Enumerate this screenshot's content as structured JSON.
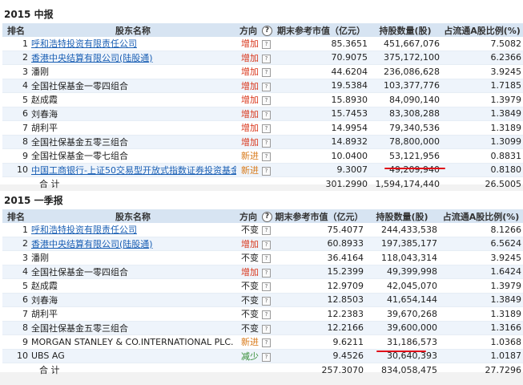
{
  "headers": {
    "rank": "排名",
    "name": "股东名称",
    "dir": "方向",
    "q": "?",
    "value": "期末参考市值（亿元）",
    "shares": "持股数量(股)",
    "ratio": "占流通A股比例(%)"
  },
  "sections": [
    {
      "title": "2015 中报",
      "rows": [
        {
          "rank": "1",
          "name": "呼和浩特投资有限责任公司",
          "link": true,
          "dir": "增加",
          "dir_type": "inc",
          "value": "85.3651",
          "shares": "451,667,076",
          "ratio": "7.5082"
        },
        {
          "rank": "2",
          "name": "香港中央结算有限公司(陆股通)",
          "link": true,
          "dir": "增加",
          "dir_type": "inc",
          "value": "70.9075",
          "shares": "375,172,100",
          "ratio": "6.2366"
        },
        {
          "rank": "3",
          "name": "潘刚",
          "link": false,
          "dir": "增加",
          "dir_type": "inc",
          "value": "44.6204",
          "shares": "236,086,628",
          "ratio": "3.9245"
        },
        {
          "rank": "4",
          "name": "全国社保基金一零四组合",
          "link": false,
          "dir": "增加",
          "dir_type": "inc",
          "value": "19.5384",
          "shares": "103,377,776",
          "ratio": "1.7185"
        },
        {
          "rank": "5",
          "name": "赵成霞",
          "link": false,
          "dir": "增加",
          "dir_type": "inc",
          "value": "15.8930",
          "shares": "84,090,140",
          "ratio": "1.3979"
        },
        {
          "rank": "6",
          "name": "刘春海",
          "link": false,
          "dir": "增加",
          "dir_type": "inc",
          "value": "15.7453",
          "shares": "83,308,288",
          "ratio": "1.3849"
        },
        {
          "rank": "7",
          "name": "胡利平",
          "link": false,
          "dir": "增加",
          "dir_type": "inc",
          "value": "14.9954",
          "shares": "79,340,536",
          "ratio": "1.3189"
        },
        {
          "rank": "8",
          "name": "全国社保基金五零三组合",
          "link": false,
          "dir": "增加",
          "dir_type": "inc",
          "value": "14.8932",
          "shares": "78,800,000",
          "ratio": "1.3099"
        },
        {
          "rank": "9",
          "name": "全国社保基金一零七组合",
          "link": false,
          "dir": "新进",
          "dir_type": "new",
          "value": "10.0400",
          "shares": "53,121,956",
          "ratio": "0.8831"
        },
        {
          "rank": "10",
          "name": "中国工商银行-上证50交易型开放式指数证券投资基金",
          "link": true,
          "dir": "新进",
          "dir_type": "new",
          "value": "9.3007",
          "shares": "49,209,940",
          "ratio": "0.8180"
        }
      ],
      "total": {
        "label": "合 计",
        "value": "301.2990",
        "shares": "1,594,174,440",
        "ratio": "26.5005"
      }
    },
    {
      "title": "2015 一季报",
      "rows": [
        {
          "rank": "1",
          "name": "呼和浩特投资有限责任公司",
          "link": true,
          "dir": "不变",
          "dir_type": "same",
          "value": "75.4077",
          "shares": "244,433,538",
          "ratio": "8.1266"
        },
        {
          "rank": "2",
          "name": "香港中央结算有限公司(陆股通)",
          "link": true,
          "dir": "增加",
          "dir_type": "inc",
          "value": "60.8933",
          "shares": "197,385,177",
          "ratio": "6.5624"
        },
        {
          "rank": "3",
          "name": "潘刚",
          "link": false,
          "dir": "不变",
          "dir_type": "same",
          "value": "36.4164",
          "shares": "118,043,314",
          "ratio": "3.9245"
        },
        {
          "rank": "4",
          "name": "全国社保基金一零四组合",
          "link": false,
          "dir": "增加",
          "dir_type": "inc",
          "value": "15.2399",
          "shares": "49,399,998",
          "ratio": "1.6424"
        },
        {
          "rank": "5",
          "name": "赵成霞",
          "link": false,
          "dir": "不变",
          "dir_type": "same",
          "value": "12.9709",
          "shares": "42,045,070",
          "ratio": "1.3979"
        },
        {
          "rank": "6",
          "name": "刘春海",
          "link": false,
          "dir": "不变",
          "dir_type": "same",
          "value": "12.8503",
          "shares": "41,654,144",
          "ratio": "1.3849"
        },
        {
          "rank": "7",
          "name": "胡利平",
          "link": false,
          "dir": "不变",
          "dir_type": "same",
          "value": "12.2383",
          "shares": "39,670,268",
          "ratio": "1.3189"
        },
        {
          "rank": "8",
          "name": "全国社保基金五零三组合",
          "link": false,
          "dir": "不变",
          "dir_type": "same",
          "value": "12.2166",
          "shares": "39,600,000",
          "ratio": "1.3166"
        },
        {
          "rank": "9",
          "name": "MORGAN STANLEY & CO.INTERNATIONAL PLC.",
          "link": false,
          "dir": "新进",
          "dir_type": "new",
          "value": "9.6211",
          "shares": "31,186,573",
          "ratio": "1.0368"
        },
        {
          "rank": "10",
          "name": "UBS AG",
          "link": false,
          "dir": "减少",
          "dir_type": "dec",
          "value": "9.4526",
          "shares": "30,640,393",
          "ratio": "1.0187"
        }
      ],
      "total": {
        "label": "合 计",
        "value": "257.3070",
        "shares": "834,058,475",
        "ratio": "27.7296"
      }
    }
  ],
  "colors": {
    "increase": "#d9361b",
    "new": "#d87a1a",
    "decrease": "#2f8a2f",
    "link": "#1a5fb4",
    "header_bg": "#d7e4f2",
    "annotation": "#e0101a"
  }
}
